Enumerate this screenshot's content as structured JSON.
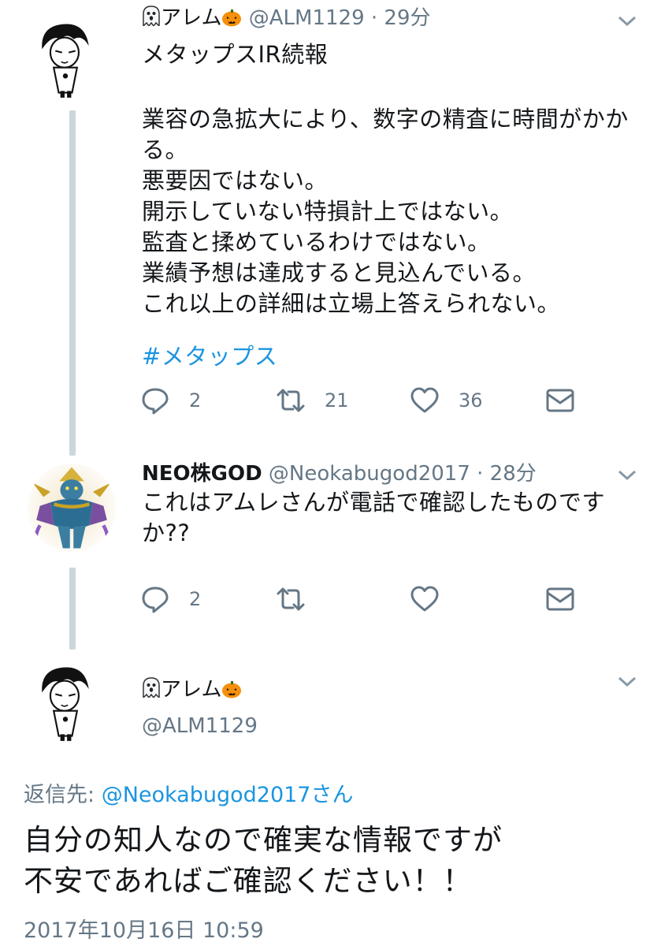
{
  "colors": {
    "text": "#14171a",
    "muted": "#657786",
    "link": "#1b95e0",
    "thread": "#ccd6dd"
  },
  "icons": [
    "ghost-icon",
    "pumpkin-icon",
    "chevron-down-icon",
    "reply-icon",
    "retweet-icon",
    "like-icon",
    "dm-icon"
  ],
  "tweet1": {
    "name": "アレム",
    "handle": "@ALM1129",
    "dot": "·",
    "time": "29分",
    "lines": [
      "メタップスIR続報",
      "",
      "業容の急拡大により、数字の精査に時間がかか",
      "る。",
      "悪要因ではない。",
      "開示していない特損計上ではない。",
      "監査と揉めているわけではない。",
      "業績予想は達成すると見込んでいる。",
      "これ以上の詳細は立場上答えられない。",
      ""
    ],
    "hashtag": "#メタップス",
    "replies": "2",
    "retweets": "21",
    "likes": "36"
  },
  "tweet2": {
    "name": "NEO株GOD",
    "handle": "@Neokabugod2017",
    "dot": "·",
    "time": "28分",
    "lines": [
      "これはアムレさんが電話で確認したものです",
      "か??"
    ],
    "replies": "2"
  },
  "tweet3": {
    "name": "アレム",
    "handle": "@ALM1129",
    "reply_prefix": "返信先: ",
    "reply_target": "@Neokabugod2017さん",
    "lines": [
      "自分の知人なので確実な情報ですが",
      "不安であればご確認ください！！"
    ],
    "timestamp": "2017年10月16日 10:59"
  }
}
